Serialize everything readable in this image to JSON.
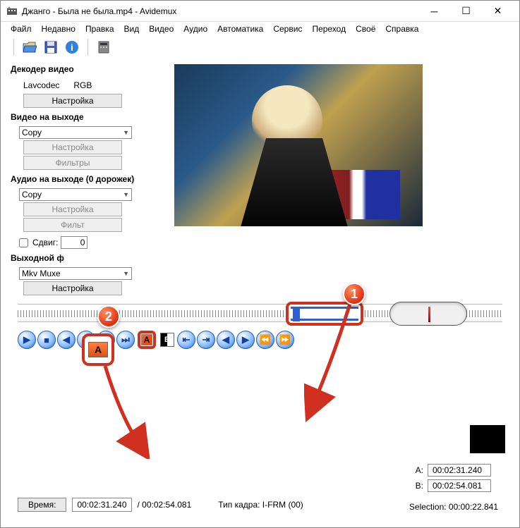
{
  "window": {
    "title": "Джанго - Была не была.mp4 - Avidemux"
  },
  "menu": {
    "file": "Файл",
    "recent": "Недавно",
    "edit": "Правка",
    "view": "Вид",
    "video": "Видео",
    "audio": "Аудио",
    "auto": "Автоматика",
    "service": "Сервис",
    "goto": "Переход",
    "custom": "Своё",
    "help": "Справка"
  },
  "decoder": {
    "title": "Декодер видео",
    "codec": "Lavcodec",
    "colorspace": "RGB",
    "settings": "Настройка"
  },
  "video_out": {
    "title": "Видео на выходе",
    "mode": "Copy",
    "settings": "Настройка",
    "filters": "Фильтры"
  },
  "audio_out": {
    "title": "Аудио на выходе (0 дорожек)",
    "mode": "Copy",
    "settings": "Настройка",
    "filters": "Фильт",
    "shift_label": "Сдвиг:",
    "shift_value": "0"
  },
  "output_format": {
    "title": "Выходной ф",
    "format": "Mkv Muxe",
    "settings": "Настройка"
  },
  "markers": {
    "a_label": "A:",
    "a_value": "00:02:31.240",
    "b_label": "B:",
    "b_value": "00:02:54.081"
  },
  "bottom": {
    "time_label": "Время:",
    "current": "00:02:31.240",
    "total": "/ 00:02:54.081",
    "frame_type": "Тип кадра:  I-FRM (00)",
    "selection": "Selection: 00:00:22.841"
  },
  "annotations": {
    "one": "1",
    "two": "2",
    "a_letter": "A"
  }
}
